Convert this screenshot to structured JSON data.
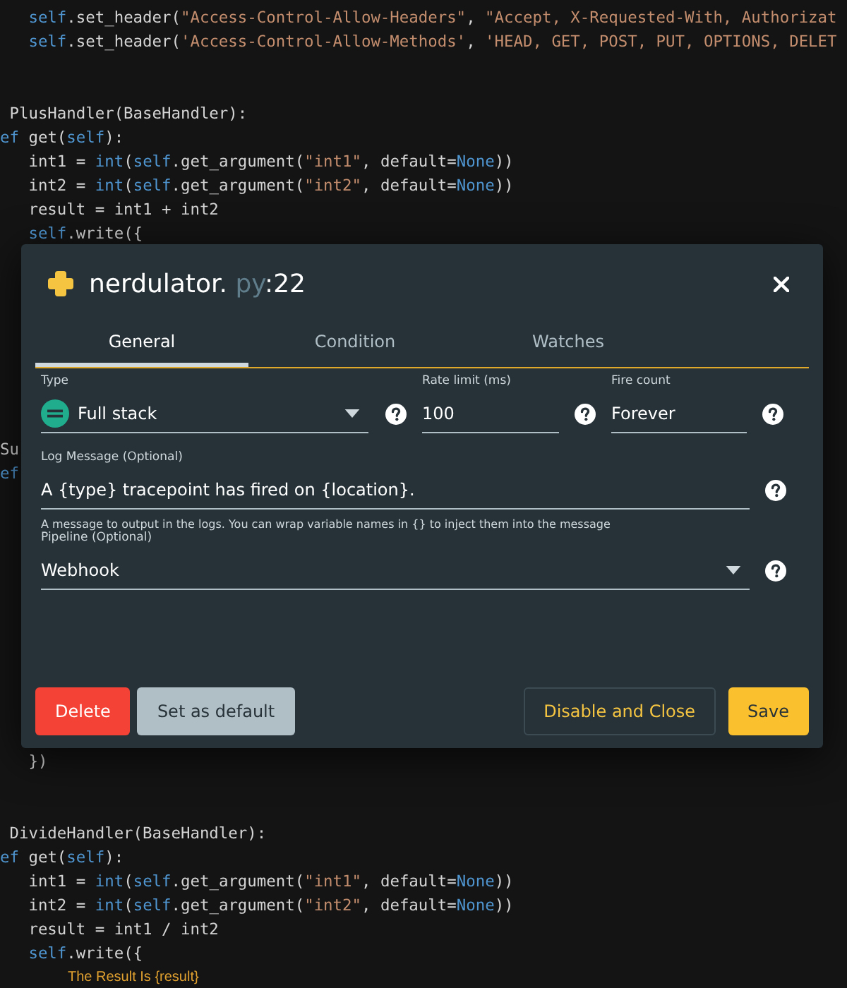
{
  "code": {
    "lines": [
      {
        "kind": "code",
        "tokens": [
          {
            "t": "   self",
            "kind": "kw"
          },
          {
            "t": ".set_header("
          },
          {
            "t": "\"Access-Control-Allow-Headers\"",
            "kind": "str"
          },
          {
            "t": ", "
          },
          {
            "t": "\"Accept, X-Requested-With, Authorizat",
            "kind": "str"
          }
        ]
      },
      {
        "kind": "code",
        "tokens": [
          {
            "t": "   self",
            "kind": "kw"
          },
          {
            "t": ".set_header("
          },
          {
            "t": "'Access-Control-Allow-Methods'",
            "kind": "str"
          },
          {
            "t": ", "
          },
          {
            "t": "'HEAD, GET, POST, PUT, OPTIONS, DELET",
            "kind": "str"
          }
        ]
      },
      {
        "kind": "blank"
      },
      {
        "kind": "blank"
      },
      {
        "kind": "code",
        "tokens": [
          {
            "t": " PlusHandler(BaseHandler):"
          }
        ]
      },
      {
        "kind": "code",
        "tokens": [
          {
            "t": "ef",
            "kind": "kw"
          },
          {
            "t": " get("
          },
          {
            "t": "self",
            "kind": "kw"
          },
          {
            "t": "):"
          }
        ]
      },
      {
        "kind": "code",
        "tokens": [
          {
            "t": "   int1 = "
          },
          {
            "t": "int",
            "kind": "kw"
          },
          {
            "t": "("
          },
          {
            "t": "self",
            "kind": "kw"
          },
          {
            "t": ".get_argument("
          },
          {
            "t": "\"int1\"",
            "kind": "str"
          },
          {
            "t": ", default="
          },
          {
            "t": "None",
            "kind": "kw"
          },
          {
            "t": "))"
          }
        ]
      },
      {
        "kind": "code",
        "tokens": [
          {
            "t": "   int2 = "
          },
          {
            "t": "int",
            "kind": "kw"
          },
          {
            "t": "("
          },
          {
            "t": "self",
            "kind": "kw"
          },
          {
            "t": ".get_argument("
          },
          {
            "t": "\"int2\"",
            "kind": "str"
          },
          {
            "t": ", default="
          },
          {
            "t": "None",
            "kind": "kw"
          },
          {
            "t": "))"
          }
        ]
      },
      {
        "kind": "code",
        "tokens": [
          {
            "t": "   result = int1 + int2"
          }
        ]
      },
      {
        "kind": "code",
        "tokens": [
          {
            "t": "   self",
            "kind": "kw"
          },
          {
            "t": ".write({"
          }
        ]
      },
      {
        "kind": "blank"
      },
      {
        "kind": "blank"
      },
      {
        "kind": "blank"
      },
      {
        "kind": "blank"
      },
      {
        "kind": "blank"
      },
      {
        "kind": "blank"
      },
      {
        "kind": "blank"
      },
      {
        "kind": "blank"
      },
      {
        "kind": "code",
        "tokens": [
          {
            "t": "Su"
          }
        ]
      },
      {
        "kind": "code",
        "tokens": [
          {
            "t": "ef",
            "kind": "kw"
          }
        ]
      },
      {
        "kind": "blank"
      },
      {
        "kind": "blank"
      },
      {
        "kind": "blank"
      },
      {
        "kind": "blank"
      },
      {
        "kind": "blank"
      },
      {
        "kind": "blank"
      },
      {
        "kind": "blank"
      },
      {
        "kind": "blank"
      },
      {
        "kind": "blank"
      },
      {
        "kind": "blank"
      },
      {
        "kind": "blank"
      },
      {
        "kind": "code",
        "tokens": [
          {
            "t": "   })"
          }
        ]
      },
      {
        "kind": "blank"
      },
      {
        "kind": "blank"
      },
      {
        "kind": "code",
        "tokens": [
          {
            "t": " DivideHandler(BaseHandler):"
          }
        ]
      },
      {
        "kind": "code",
        "tokens": [
          {
            "t": "ef",
            "kind": "kw"
          },
          {
            "t": " get("
          },
          {
            "t": "self",
            "kind": "kw"
          },
          {
            "t": "):"
          }
        ]
      },
      {
        "kind": "code",
        "tokens": [
          {
            "t": "   int1 = "
          },
          {
            "t": "int",
            "kind": "kw"
          },
          {
            "t": "("
          },
          {
            "t": "self",
            "kind": "kw"
          },
          {
            "t": ".get_argument("
          },
          {
            "t": "\"int1\"",
            "kind": "str"
          },
          {
            "t": ", default="
          },
          {
            "t": "None",
            "kind": "kw"
          },
          {
            "t": "))"
          }
        ]
      },
      {
        "kind": "code",
        "tokens": [
          {
            "t": "   int2 = "
          },
          {
            "t": "int",
            "kind": "kw"
          },
          {
            "t": "("
          },
          {
            "t": "self",
            "kind": "kw"
          },
          {
            "t": ".get_argument("
          },
          {
            "t": "\"int2\"",
            "kind": "str"
          },
          {
            "t": ", default="
          },
          {
            "t": "None",
            "kind": "kw"
          },
          {
            "t": "))"
          }
        ]
      },
      {
        "kind": "code",
        "tokens": [
          {
            "t": "   result = int1 / int2"
          }
        ]
      },
      {
        "kind": "code",
        "tokens": [
          {
            "t": "   self",
            "kind": "kw"
          },
          {
            "t": ".write({"
          }
        ]
      },
      {
        "kind": "hint",
        "text": "The Result Is {result}"
      }
    ]
  },
  "dialog": {
    "title": {
      "file": "nerdulator.",
      "ext": "py",
      "line": ":22"
    },
    "tabs": [
      {
        "label": "General",
        "selected": true
      },
      {
        "label": "Condition",
        "selected": false
      },
      {
        "label": "Watches",
        "selected": false
      }
    ],
    "type": {
      "label": "Type",
      "value": "Full stack"
    },
    "rate_limit": {
      "label": "Rate limit (ms)",
      "value": "100"
    },
    "fire_count": {
      "label": "Fire count",
      "value": "Forever"
    },
    "log_message": {
      "label": "Log Message (Optional)",
      "value": "A {type} tracepoint has fired on {location}.",
      "hint": "A message to output in the logs. You can wrap variable names in {} to inject them into the message"
    },
    "pipeline": {
      "label": "Pipeline (Optional)",
      "value": "Webhook"
    },
    "buttons": [
      {
        "label": "Delete",
        "kind": "danger"
      },
      {
        "label": "Set as default",
        "kind": "secondary"
      },
      {
        "label": "Disable and Close",
        "kind": "outline"
      },
      {
        "label": "Save",
        "kind": "primary"
      }
    ]
  }
}
